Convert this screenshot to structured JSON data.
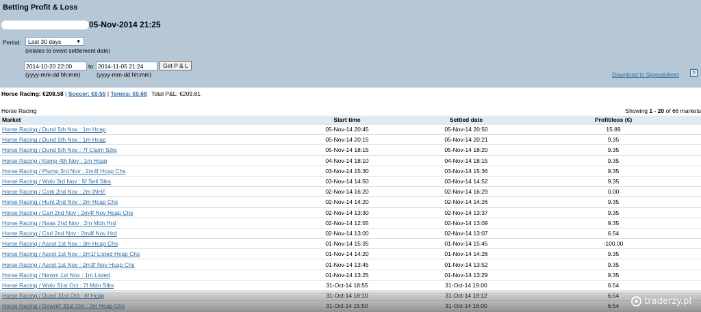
{
  "header": {
    "title": "Betting Profit & Loss",
    "datetime": "05-Nov-2014 21:25",
    "period_label": "Period:",
    "period_value": "Last 30 days",
    "period_note": "(relates to event settlement date)",
    "from_date": "2014-10-20 22:00",
    "to_label": "to",
    "to_date": "2014-11-05 21:24",
    "get_button": "Get P & L",
    "date_format": "(yyyy-mm-dd hh:mm)",
    "download_link": "Download to Spreadsheet",
    "help_label": "?"
  },
  "summary": {
    "horse_racing_label": "Horse Racing: €208.58",
    "sep1": "|",
    "soccer_link": "Soccer: €0.55",
    "sep2": "|",
    "tennis_link": "Tennis: €0.68",
    "total": "Total P&L:  €209.81"
  },
  "table": {
    "section": "Horse Racing",
    "showing_prefix": "Showing ",
    "showing_range": "1 - 20",
    "showing_suffix": " of 66 markets",
    "columns": [
      "Market",
      "Start time",
      "Settled date",
      "Profit/loss (€)"
    ],
    "rows": [
      {
        "market": "Horse Racing / Dund 5th Nov : 1m Hcap",
        "start": "05-Nov-14 20:45",
        "settled": "05-Nov-14 20:50",
        "pl": "15.89"
      },
      {
        "market": "Horse Racing / Dund 5th Nov : 1m Hcap",
        "start": "05-Nov-14 20:15",
        "settled": "05-Nov-14 20:21",
        "pl": "9.35"
      },
      {
        "market": "Horse Racing / Dund 5th Nov : 7f Claim Stks",
        "start": "05-Nov-14 18:15",
        "settled": "05-Nov-14 18:20",
        "pl": "9.35"
      },
      {
        "market": "Horse Racing / Kemp 4th Nov : 1m Hcap",
        "start": "04-Nov-14 18:10",
        "settled": "04-Nov-14 18:15",
        "pl": "9.35"
      },
      {
        "market": "Horse Racing / Plump 3rd Nov : 2m4f Hcap Chs",
        "start": "03-Nov-14 15:30",
        "settled": "03-Nov-14 15:36",
        "pl": "9.35"
      },
      {
        "market": "Horse Racing / Wolv 3rd Nov : 5f Sell Stks",
        "start": "03-Nov-14 14:50",
        "settled": "03-Nov-14 14:52",
        "pl": "9.35"
      },
      {
        "market": "Horse Racing / Cork 2nd Nov : 2m INHF",
        "start": "02-Nov-14 16:20",
        "settled": "02-Nov-14 16:29",
        "pl": "0.00"
      },
      {
        "market": "Horse Racing / Hunt 2nd Nov : 2m Hcap Chs",
        "start": "02-Nov-14 14:20",
        "settled": "02-Nov-14 14:26",
        "pl": "9.35"
      },
      {
        "market": "Horse Racing / Carl 2nd Nov : 2m4f Nov Hcap Chs",
        "start": "02-Nov-14 13:30",
        "settled": "02-Nov-14 13:37",
        "pl": "9.35"
      },
      {
        "market": "Horse Racing / Naas 2nd Nov : 2m Mdn Hrd",
        "start": "02-Nov-14 12:55",
        "settled": "02-Nov-14 13:09",
        "pl": "9.35"
      },
      {
        "market": "Horse Racing / Carl 2nd Nov : 2m4f Nov Hrd",
        "start": "02-Nov-14 13:00",
        "settled": "02-Nov-14 13:07",
        "pl": "6.54"
      },
      {
        "market": "Horse Racing / Ascot 1st Nov : 3m Hcap Chs",
        "start": "01-Nov-14 15:35",
        "settled": "01-Nov-14 15:45",
        "pl": "-100.00"
      },
      {
        "market": "Horse Racing / Ascot 1st Nov : 2m1f Listed Hcap Chs",
        "start": "01-Nov-14 14:20",
        "settled": "01-Nov-14 14:26",
        "pl": "9.35"
      },
      {
        "market": "Horse Racing / Ascot 1st Nov : 2m3f Nov Hcap Chs",
        "start": "01-Nov-14 13:45",
        "settled": "01-Nov-14 13:52",
        "pl": "9.35"
      },
      {
        "market": "Horse Racing / Newm 1st Nov : 1m Listed",
        "start": "01-Nov-14 13:25",
        "settled": "01-Nov-14 13:29",
        "pl": "9.35"
      },
      {
        "market": "Horse Racing / Wolv 31st Oct : 7f Mdn Stks",
        "start": "31-Oct-14 18:55",
        "settled": "31-Oct-14 19:00",
        "pl": "6.54"
      },
      {
        "market": "Horse Racing / Dund 31st Oct : 6f Hcap",
        "start": "31-Oct-14 18:10",
        "settled": "31-Oct-14 18:12",
        "pl": "6.54"
      },
      {
        "market": "Horse Racing / DownR 31st Oct : 2m Hcap Chs",
        "start": "31-Oct-14 15:50",
        "settled": "31-Oct-14 16:00",
        "pl": "6.54"
      }
    ]
  },
  "watermark": {
    "text": "traderzy.pl",
    "icon": "traderzy-logo-icon"
  },
  "colors": {
    "header_bg": "#b6c8d6",
    "link": "#2e6da4",
    "table_header_bg": "#e0eaf2"
  }
}
